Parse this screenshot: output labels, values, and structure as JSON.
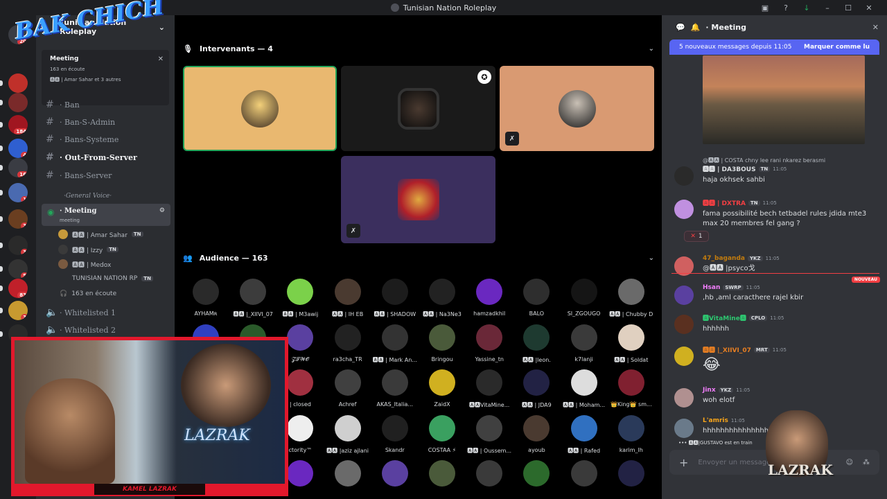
{
  "window": {
    "title": "Tunisian Nation Roleplay"
  },
  "sidebar": {
    "server_name": "Tunisian Nation Roleplay",
    "event_title": "Meeting",
    "event_listeners": "163 en écoute",
    "event_users": "🅰🅰 | Amar Sahar et 3 autres",
    "channels": [
      {
        "label": "· Ban"
      },
      {
        "label": "· Ban-S-Admin"
      },
      {
        "label": "· Bans-Systeme"
      },
      {
        "label": "· Out-From-Server"
      },
      {
        "label": "· Bans-Server"
      }
    ],
    "category": "·General Voice·",
    "stage_channel": {
      "label": "· Meeting",
      "sub": "meeting"
    },
    "voice_users": [
      {
        "name": "🅰🅰 | Amar Sahar",
        "tag": "TN"
      },
      {
        "name": "🅰🅰 | Izzy",
        "tag": "TN"
      },
      {
        "name": "🅰🅰 | Medox",
        "tag": ""
      },
      {
        "name": "TUNISIAN NATION RP",
        "tag": "TN"
      }
    ],
    "listening": "163 en écoute",
    "other_channels": [
      {
        "label": "· Whitelisted 1"
      },
      {
        "label": "· Whitelisted 2"
      }
    ],
    "server_badges": [
      "20",
      "184",
      "4",
      "16",
      "1",
      "3",
      "3",
      "5",
      "83",
      "3"
    ]
  },
  "stage": {
    "header": "Meeting",
    "speakers_label": "Intervenants — 4",
    "audience_label": "Audience — 163",
    "audience": [
      "AYHAMʀ",
      "🅰🅰 |_XIIVI_07",
      "🅰🅰 | M3awij",
      "🅰🅰 | IH EB",
      "🅰🅰 | SHADOW",
      "🅰🅰 | Na3Ne3",
      "hamzadkhil",
      "BALO",
      "SI_ZGOUGO",
      "🅰🅰 | Chubby D",
      "",
      "",
      "𝓩𝓣𝓦𝓞",
      "ra3cha_TR",
      "🅰🅰 | Mark An...",
      "Bringou",
      "Yassine_tn",
      "🅰🅰 |leon.",
      "k7lanji",
      "🅰🅰 | Soldat",
      "",
      "",
      "| closed",
      "Achref",
      "AKAS_Italia...",
      "ZaidX",
      "🅰🅰VitaMine...",
      "🅰🅰 | JDA9",
      "🅰🅰 | Moham...",
      "👑King👑 sm...",
      "",
      "",
      "ctority™",
      "🅰🅰 |aziz ajlani",
      "Skandr",
      "COSTAA ⚡",
      "🅰🅰 | Oussem...",
      "ayoub",
      "🅰🅰 | Rafed",
      "karim_lh"
    ]
  },
  "chat": {
    "title": "· Meeting",
    "new_bar": "5 nouveaux messages depuis 11:05",
    "mark_read": "Marquer comme lu",
    "messages": [
      {
        "reply": "@🅰🅰 | COSTA  chny lee rani nkarez berasmi",
        "author": "🅰🅰 | DA3BOUS",
        "tag": "TN",
        "time": "11:05",
        "text": "haja okhsek sahbi",
        "color": "#dbdee1"
      },
      {
        "author": "🅰🅰 | DXTRA",
        "tag": "TN",
        "time": "11:05",
        "text": "fama possibilité bech tetbadel rules jdida mte3 max 20 membres fel gang ?",
        "color": "#f23f43"
      },
      {
        "author": "47_baganda",
        "tag": "YKZ",
        "time": "11:05",
        "text": "@🅰🅰 |psyco戈",
        "color": "#c27c0e"
      },
      {
        "author": "Hsan",
        "tag": "SWRP",
        "time": "11:05",
        "text": ",hb ,aml caracthere rajel kbir",
        "color": "#f47fff"
      },
      {
        "author": "🅰VitaMine🅰",
        "tag": "CPLO",
        "time": "11:05",
        "text": "hhhhhh",
        "color": "#2dc770"
      },
      {
        "author": "🅰🅰 |_XIIVI_07",
        "tag": "MRT",
        "time": "11:05",
        "text": "😂",
        "color": "#e67e22"
      },
      {
        "author": "Jinx",
        "tag": "YKZ",
        "time": "11:05",
        "text": "woh elotf",
        "color": "#f47fff"
      },
      {
        "author": "L'amris",
        "tag": "",
        "time": "11:05",
        "text": "hhhhhhhhhhhhhhh",
        "color": "#faa61a"
      }
    ],
    "reaction_count": "1",
    "new_label": "NOUVEAU",
    "typing": "🅰🅰|GUSTAVO est en train",
    "input_placeholder": "Envoyer un message"
  },
  "overlay": {
    "logo_text": "BAK CHICH",
    "streamer": "KAMEL LAZRAK",
    "corner_logo": "LAZRAK"
  }
}
